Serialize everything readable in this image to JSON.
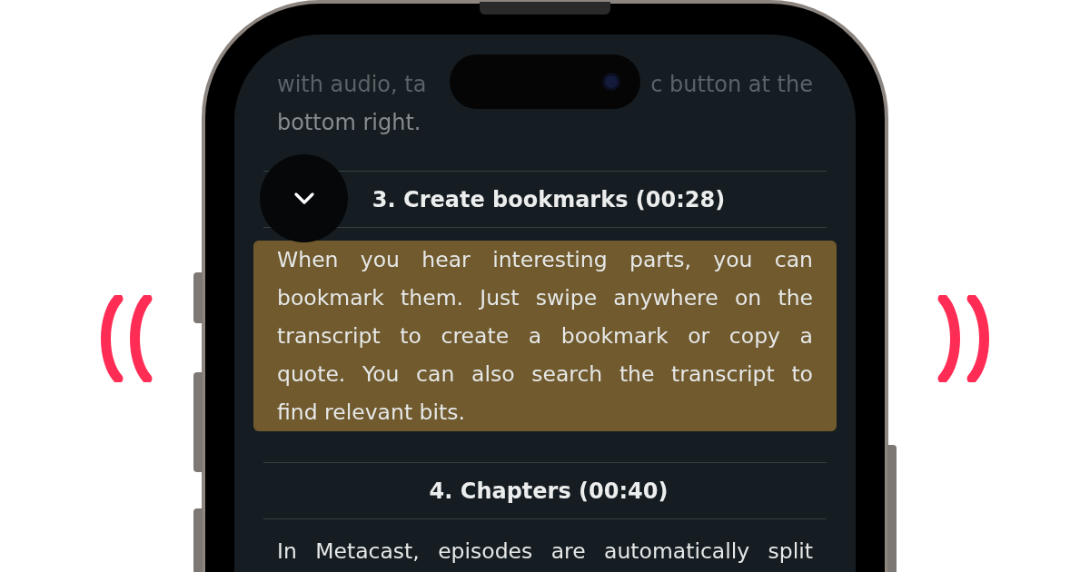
{
  "previous_paragraph": {
    "left_fragment": "with audio, ta",
    "right_fragment": "c button at the",
    "last_line": "bottom right."
  },
  "sections": [
    {
      "heading": "3. Create bookmarks (00:28)",
      "highlighted": true,
      "cut_off": false,
      "lines": [
        "When you hear interesting parts, you can",
        "bookmark them. Just swipe anywhere on the",
        "transcript to create a bookmark or copy a",
        "quote. You can also search the transcript to",
        "find relevant bits."
      ]
    },
    {
      "heading": "4. Chapters (00:40)",
      "highlighted": false,
      "cut_off": true,
      "lines": [
        "In Metacast, episodes are automatically split"
      ]
    }
  ]
}
